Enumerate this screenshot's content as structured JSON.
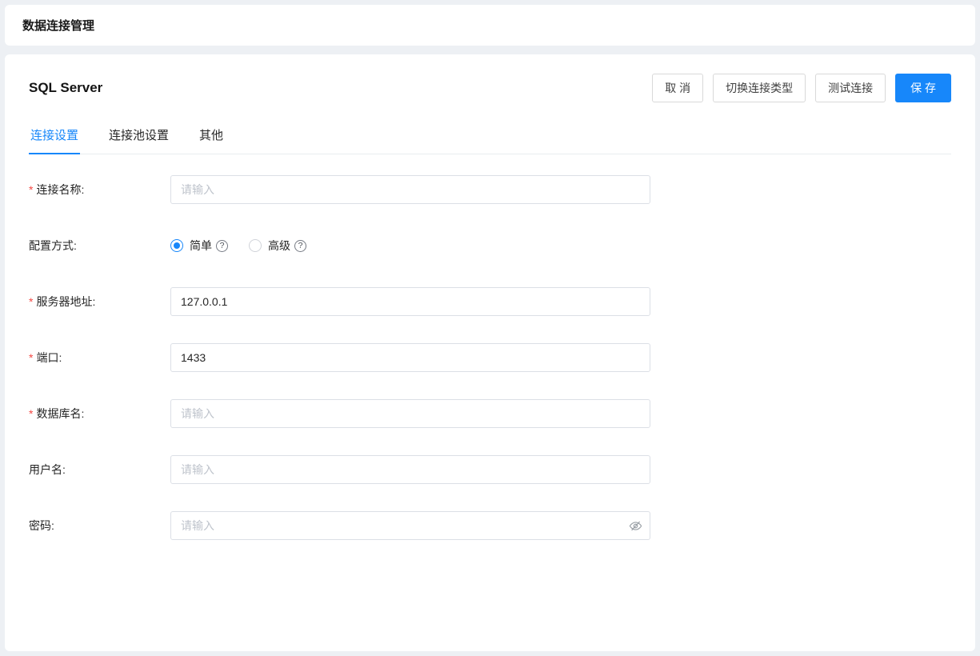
{
  "colors": {
    "accent": "#1787fa",
    "required": "#f54a45"
  },
  "header": {
    "title": "数据连接管理"
  },
  "panel": {
    "title": "SQL Server",
    "actions": {
      "cancel": "取 消",
      "switch_type": "切换连接类型",
      "test": "测试连接",
      "save": "保 存"
    }
  },
  "tabs": {
    "active": "连接设置",
    "items": [
      {
        "label": "连接设置"
      },
      {
        "label": "连接池设置"
      },
      {
        "label": "其他"
      }
    ]
  },
  "form": {
    "required_mark": "*",
    "help_mark": "?",
    "fields": {
      "connection_name": {
        "label": "连接名称:",
        "required": true,
        "placeholder": "请输入",
        "value": ""
      },
      "config_mode": {
        "label": "配置方式:",
        "required": false,
        "options": [
          {
            "label": "简单",
            "selected": true,
            "has_help": true
          },
          {
            "label": "高级",
            "selected": false,
            "has_help": true
          }
        ]
      },
      "server_address": {
        "label": "服务器地址:",
        "required": true,
        "value": "127.0.0.1"
      },
      "port": {
        "label": "端口:",
        "required": true,
        "value": "1433"
      },
      "database_name": {
        "label": "数据库名:",
        "required": true,
        "placeholder": "请输入",
        "value": ""
      },
      "username": {
        "label": "用户名:",
        "required": false,
        "placeholder": "请输入",
        "value": ""
      },
      "password": {
        "label": "密码:",
        "required": false,
        "placeholder": "请输入",
        "value": "",
        "masked": true
      }
    }
  }
}
